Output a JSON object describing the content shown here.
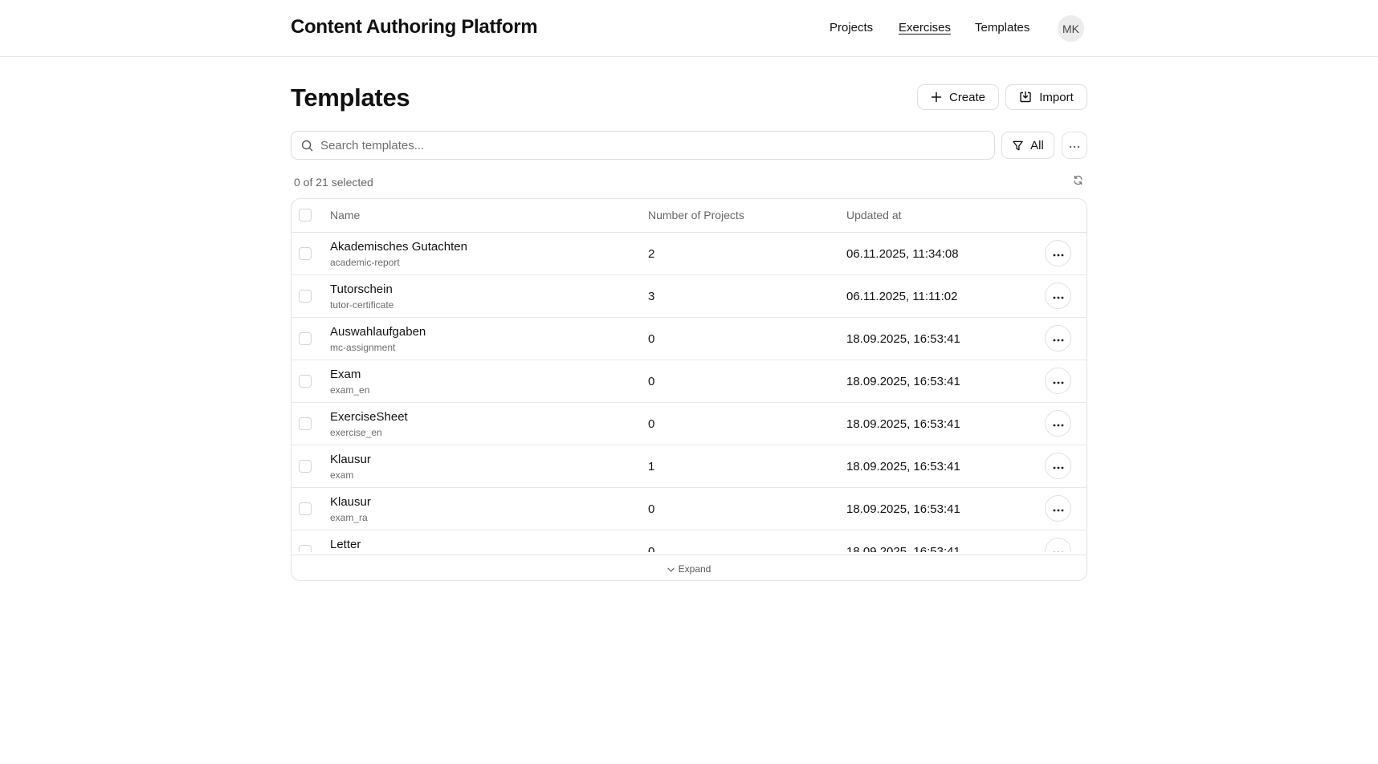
{
  "app": {
    "title": "Content Authoring Platform"
  },
  "nav": {
    "items": [
      {
        "label": "Projects",
        "active": false
      },
      {
        "label": "Exercises",
        "active": true
      },
      {
        "label": "Templates",
        "active": false
      }
    ],
    "avatar_initials": "MK"
  },
  "page": {
    "title": "Templates",
    "create_label": "Create",
    "import_label": "Import"
  },
  "search": {
    "placeholder": "Search templates...",
    "value": ""
  },
  "filter": {
    "label": "All"
  },
  "selection": {
    "text": "0 of 21 selected"
  },
  "table": {
    "columns": [
      "Name",
      "Number of Projects",
      "Updated at"
    ],
    "rows": [
      {
        "name": "Akademisches Gutachten",
        "slug": "academic-report",
        "projects": "2",
        "updated": "06.11.2025, 11:34:08"
      },
      {
        "name": "Tutorschein",
        "slug": "tutor-certificate",
        "projects": "3",
        "updated": "06.11.2025, 11:11:02"
      },
      {
        "name": "Auswahlaufgaben",
        "slug": "mc-assignment",
        "projects": "0",
        "updated": "18.09.2025, 16:53:41"
      },
      {
        "name": "Exam",
        "slug": "exam_en",
        "projects": "0",
        "updated": "18.09.2025, 16:53:41"
      },
      {
        "name": "ExerciseSheet",
        "slug": "exercise_en",
        "projects": "0",
        "updated": "18.09.2025, 16:53:41"
      },
      {
        "name": "Klausur",
        "slug": "exam",
        "projects": "1",
        "updated": "18.09.2025, 16:53:41"
      },
      {
        "name": "Klausur",
        "slug": "exam_ra",
        "projects": "0",
        "updated": "18.09.2025, 16:53:41"
      },
      {
        "name": "Letter",
        "slug": "",
        "projects": "0",
        "updated": "18.09.2025, 16:53:41"
      }
    ],
    "expand_label": "Expand"
  },
  "icons": {
    "create": "plus-icon",
    "import": "import-icon",
    "search": "search-icon",
    "filter": "filter-icon",
    "more": "more-horizontal-icon",
    "refresh": "refresh-icon",
    "row_action": "more-horizontal-icon",
    "expand": "chevron-down-icon"
  }
}
